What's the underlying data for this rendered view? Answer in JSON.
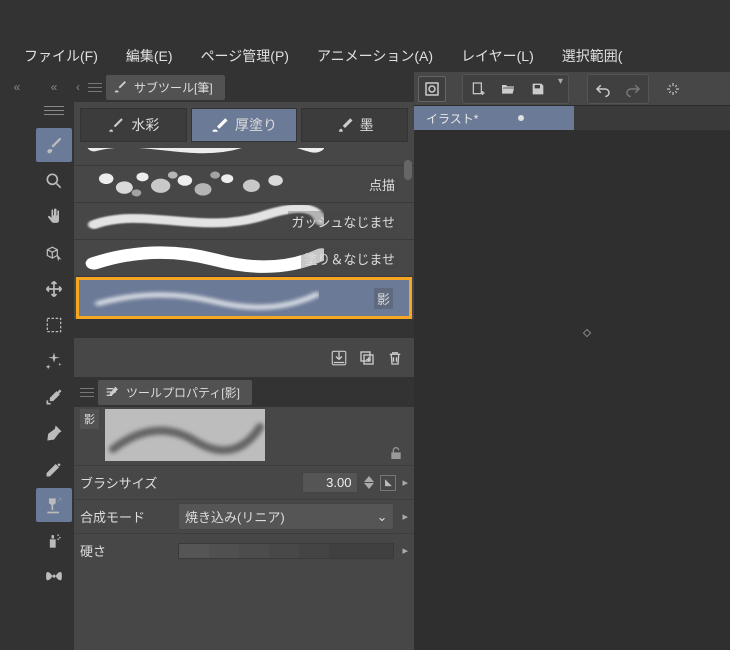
{
  "menu": {
    "file": "ファイル(F)",
    "edit": "編集(E)",
    "page": "ページ管理(P)",
    "animation": "アニメーション(A)",
    "layer": "レイヤー(L)",
    "selection": "選択範囲("
  },
  "doc_tab": "イラスト*",
  "subtool": {
    "title": "サブツール[筆]",
    "tabs": {
      "watercolor": "水彩",
      "thick": "厚塗り",
      "ink": "墨"
    },
    "brushes": {
      "pointillism": "点描",
      "gouache_blend": "ガッシュなじませ",
      "paint_blend": "塗り＆なじませ",
      "shadow": "影"
    }
  },
  "tool_property": {
    "title": "ツールプロパティ[影]",
    "preview_label": "影",
    "brush_size_label": "ブラシサイズ",
    "brush_size_value": "3.00",
    "blend_mode_label": "合成モード",
    "blend_mode_value": "焼き込み(リニア)",
    "hardness_label": "硬さ"
  }
}
